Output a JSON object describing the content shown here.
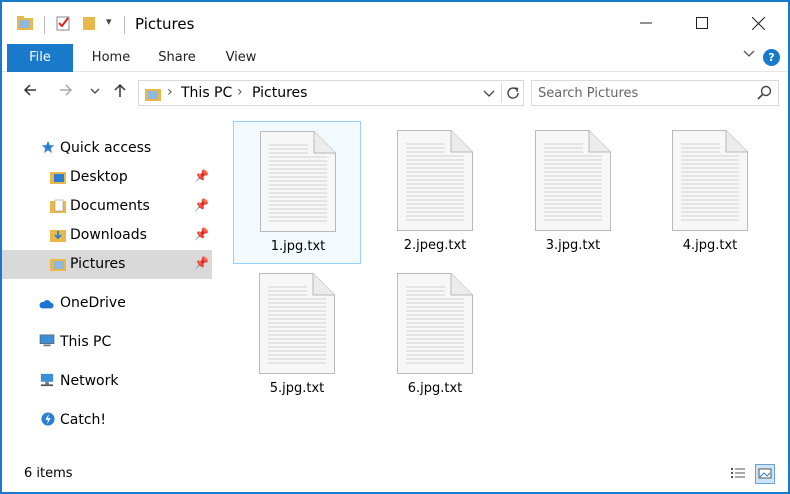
{
  "window": {
    "title": "Pictures"
  },
  "ribbon": {
    "tabs": [
      {
        "label": "File"
      },
      {
        "label": "Home"
      },
      {
        "label": "Share"
      },
      {
        "label": "View"
      }
    ],
    "help_label": "?"
  },
  "address": {
    "crumbs": [
      "This PC",
      "Pictures"
    ]
  },
  "search": {
    "placeholder": "Search Pictures"
  },
  "sidebar": {
    "items": [
      {
        "label": "Quick access",
        "icon": "star-icon"
      },
      {
        "label": "Desktop",
        "icon": "desktop-folder-icon",
        "pinned": true
      },
      {
        "label": "Documents",
        "icon": "documents-folder-icon",
        "pinned": true
      },
      {
        "label": "Downloads",
        "icon": "downloads-folder-icon",
        "pinned": true
      },
      {
        "label": "Pictures",
        "icon": "pictures-folder-icon",
        "pinned": true,
        "selected": true
      },
      {
        "label": "OneDrive",
        "icon": "cloud-icon"
      },
      {
        "label": "This PC",
        "icon": "computer-icon"
      },
      {
        "label": "Network",
        "icon": "network-icon"
      },
      {
        "label": "Catch!",
        "icon": "catch-icon"
      }
    ]
  },
  "files": [
    {
      "name": "1.jpg.txt",
      "selected": true
    },
    {
      "name": "2.jpeg.txt"
    },
    {
      "name": "3.jpg.txt"
    },
    {
      "name": "4.jpg.txt"
    },
    {
      "name": "5.jpg.txt"
    },
    {
      "name": "6.jpg.txt"
    }
  ],
  "status": {
    "item_count": "6 items"
  },
  "colors": {
    "accent": "#1979ca",
    "selection": "#cce8ff"
  }
}
